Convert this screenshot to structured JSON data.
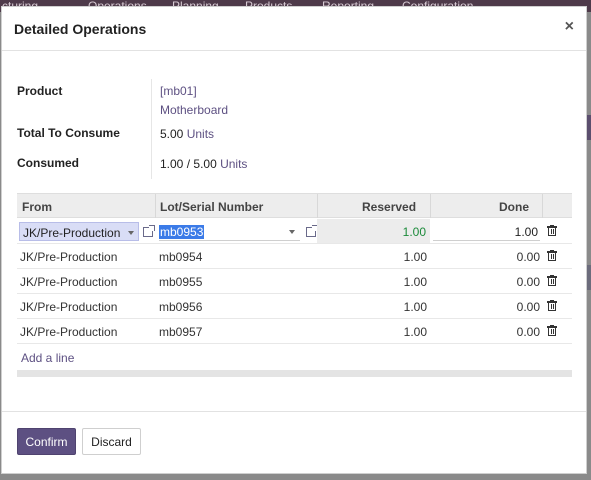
{
  "background": {
    "nav_items": [
      "cturing",
      "Operations",
      "Planning",
      "Products",
      "Reporting",
      "Configuration"
    ]
  },
  "dialog": {
    "title": "Detailed Operations",
    "close_label": "×"
  },
  "summary": {
    "product_label": "Product",
    "product_code": "[mb01]",
    "product_name": "Motherboard",
    "total_label": "Total To Consume",
    "total_qty": "5.00",
    "total_uom": "Units",
    "consumed_label": "Consumed",
    "consumed_qty": "1.00",
    "consumed_sep": "/",
    "consumed_total": "5.00",
    "consumed_uom": "Units"
  },
  "table": {
    "columns": {
      "from": "From",
      "lot": "Lot/Serial Number",
      "reserved": "Reserved",
      "done": "Done"
    },
    "rows": [
      {
        "from": "JK/Pre-Production",
        "lot": "mb0953",
        "reserved": "1.00",
        "done": "1.00"
      },
      {
        "from": "JK/Pre-Production",
        "lot": "mb0954",
        "reserved": "1.00",
        "done": "0.00"
      },
      {
        "from": "JK/Pre-Production",
        "lot": "mb0955",
        "reserved": "1.00",
        "done": "0.00"
      },
      {
        "from": "JK/Pre-Production",
        "lot": "mb0956",
        "reserved": "1.00",
        "done": "0.00"
      },
      {
        "from": "JK/Pre-Production",
        "lot": "mb0957",
        "reserved": "1.00",
        "done": "0.00"
      }
    ],
    "add_line": "Add a line"
  },
  "footer": {
    "confirm": "Confirm",
    "discard": "Discard"
  },
  "colors": {
    "primary": "#5d5082",
    "reserved_green": "#1b8a3a",
    "selection_blue": "#3b7be8"
  }
}
